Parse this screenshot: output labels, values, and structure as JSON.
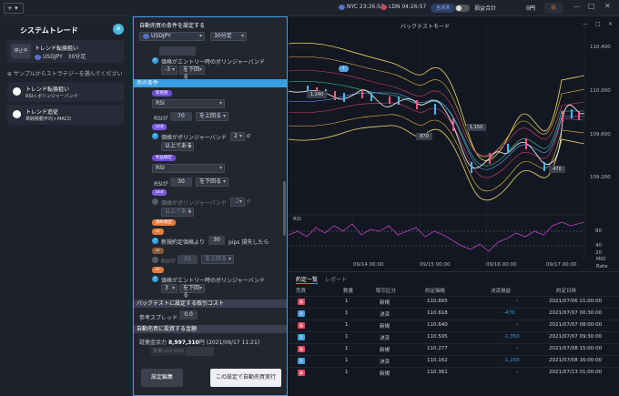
{
  "topbar": {
    "plus": "+ ▾",
    "nyc": "NYC 23:26:57",
    "ldn": "LDN 04:26:57",
    "market": "全決済",
    "pl_label": "損益合計",
    "pl_value": "0円"
  },
  "left": {
    "title": "システムトレード",
    "running": {
      "badge": "停止中",
      "name": "トレンド転換狙い",
      "pair": "USDJPY",
      "tf": "30分足"
    },
    "sample_prompt": "サンプルからストラテジーを選んでください",
    "samples": [
      {
        "name": "トレンド転換狙い",
        "desc": "RSI＋ボリンジャーバンド"
      },
      {
        "name": "トレンド追従",
        "desc": "単純移動平均＋MACD"
      }
    ]
  },
  "modal": {
    "header": "自動売買の条件を設定する",
    "pair": "USDJPY",
    "tf": "30分足",
    "top_cond": {
      "label": "価格がエントリー時のボリンジャーバンド",
      "value": "-3",
      "op": "を下回る"
    },
    "sell_head": "売の条件",
    "new_order_tag": "新規買",
    "new_indicator": "RSI",
    "rsi_label1": "RSIが",
    "rsi_val1": "70",
    "rsi_op1": "を上回る",
    "and1": "and",
    "bb_label1": "価格がボリンジャーバンド",
    "bb_val1": "2",
    "bb_unit1": "σ",
    "bb_op1": "以上である",
    "profit_tag": "利益確定",
    "profit_indicator": "RSI",
    "rsi_label2": "RSIが",
    "rsi_val2": "30",
    "rsi_op2": "を下回る",
    "and2": "and",
    "bb_label2": "価格がボリンジャーバンド",
    "bb_val2": "-2",
    "bb_unit2": "σ",
    "bb_op2": "以上である",
    "loss_tag": "損失確定",
    "or1": "or",
    "pips_label": "新規約定価格より",
    "pips_val": "30",
    "pips_suffix": "pips 損失したら",
    "or2": "or",
    "rsi_label3": "RSIが",
    "rsi_val3": "25",
    "rsi_op3": "を上回る",
    "or3": "or",
    "bb_label3": "価格がエントリー時のボリンジャーバンド",
    "bb_val3": "3",
    "bb_op3": "を下回る",
    "cost_head": "バックテストに設定する取引コスト",
    "spread_label": "参考スプレッド",
    "spread_val": "0.0",
    "fund_head": "自動売買に投資する金額",
    "margin_label": "証拠金余力",
    "margin_val": "8,997,310",
    "margin_unit": "円",
    "margin_date": "(2021/09/17 11:21)",
    "qty_label": "数量(x10,000)",
    "edit_btn": "設定編集",
    "run_btn": "この設定で自動売買実行"
  },
  "chart": {
    "title": "バックテストモード",
    "yticks": [
      "110.400",
      "110.000",
      "109.600",
      "109.200"
    ],
    "rsi_label": "RSI",
    "rsi_ticks": [
      "80",
      "40",
      "20"
    ],
    "xticks": [
      "09/14 00:00",
      "09/15 00:00",
      "09/16 00:00",
      "09/17 00:00"
    ],
    "corner1": "MID",
    "corner2": "Rate",
    "trade_labels": [
      "1,240",
      "870",
      "1,150",
      "470"
    ]
  },
  "table": {
    "tabs": [
      "約定一覧",
      "レポート"
    ],
    "headers": [
      "売買",
      "数量",
      "取引区分",
      "約定価格",
      "決済損益",
      "約定日時"
    ],
    "rows": [
      {
        "side": "買",
        "sc": "#e8455f",
        "qty": "1",
        "kind": "新規",
        "price": "110.665",
        "pl": "-",
        "date": "2021/07/06 21:00:00"
      },
      {
        "side": "売",
        "sc": "#3a9fe0",
        "qty": "1",
        "kind": "決済",
        "price": "110.618",
        "pl": "-470",
        "date": "2021/07/07 00:30:00"
      },
      {
        "side": "買",
        "sc": "#e8455f",
        "qty": "1",
        "kind": "新規",
        "price": "110.640",
        "pl": "-",
        "date": "2021/07/07 08:00:00"
      },
      {
        "side": "売",
        "sc": "#3a9fe0",
        "qty": "1",
        "kind": "決済",
        "price": "110.505",
        "pl": "-1,350",
        "date": "2021/07/07 09:30:00"
      },
      {
        "side": "買",
        "sc": "#e8455f",
        "qty": "1",
        "kind": "新規",
        "price": "110.277",
        "pl": "-",
        "date": "2021/07/08 15:00:00"
      },
      {
        "side": "売",
        "sc": "#3a9fe0",
        "qty": "1",
        "kind": "決済",
        "price": "110.162",
        "pl": "-1,150",
        "date": "2021/07/08 16:00:00"
      },
      {
        "side": "買",
        "sc": "#e8455f",
        "qty": "1",
        "kind": "新規",
        "price": "110.361",
        "pl": "-",
        "date": "2021/07/13 01:00:00"
      }
    ]
  }
}
